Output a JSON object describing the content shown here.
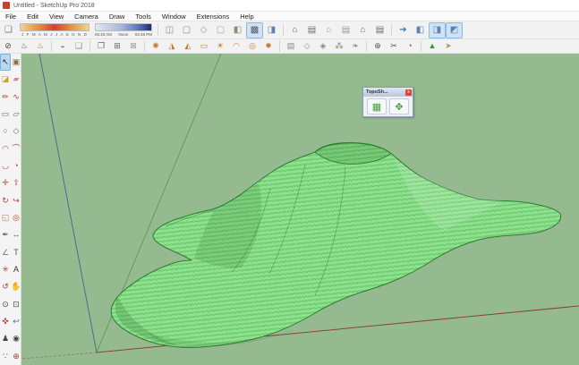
{
  "window": {
    "title": "Untitled - SketchUp Pro 2018"
  },
  "menu": {
    "items": [
      {
        "name": "menu-file",
        "label": "File"
      },
      {
        "name": "menu-edit",
        "label": "Edit"
      },
      {
        "name": "menu-view",
        "label": "View"
      },
      {
        "name": "menu-camera",
        "label": "Camera"
      },
      {
        "name": "menu-draw",
        "label": "Draw"
      },
      {
        "name": "menu-tools",
        "label": "Tools"
      },
      {
        "name": "menu-window",
        "label": "Window"
      },
      {
        "name": "menu-extensions",
        "label": "Extensions"
      },
      {
        "name": "menu-help",
        "label": "Help"
      }
    ]
  },
  "shadows": {
    "toggle_glyph": "❏",
    "months": "J F M A M J J A S O N D",
    "time_start": "06:43 AM",
    "time_mid": "Noon",
    "time_end": "04:45 PM"
  },
  "toolbar1": {
    "face_styles": [
      {
        "name": "xray-style-icon",
        "glyph": "◫",
        "color": "#7d92a8"
      },
      {
        "name": "back-edges-style-icon",
        "glyph": "▢",
        "color": "#7d92a8"
      },
      {
        "name": "wireframe-style-icon",
        "glyph": "◇",
        "color": "#8a97a3"
      },
      {
        "name": "hidden-line-style-icon",
        "glyph": "▢",
        "color": "#9aa4ad"
      },
      {
        "name": "shaded-style-icon",
        "glyph": "◧",
        "color": "#8d8d7a"
      },
      {
        "name": "shaded-textures-style-icon",
        "glyph": "▩",
        "color": "#4f5a66",
        "active": true
      },
      {
        "name": "monochrome-style-icon",
        "glyph": "◨",
        "color": "#5b82b5"
      }
    ],
    "views": [
      {
        "name": "iso-view-icon",
        "glyph": "⌂",
        "color": "#6a6a6a"
      },
      {
        "name": "top-view-icon",
        "glyph": "▤",
        "color": "#6a6a6a"
      },
      {
        "name": "front-view-icon",
        "glyph": "⌂",
        "color": "#9a9a9a"
      },
      {
        "name": "right-view-icon",
        "glyph": "▤",
        "color": "#9a9a9a"
      },
      {
        "name": "back-view-icon",
        "glyph": "⌂",
        "color": "#6a6a6a"
      },
      {
        "name": "left-view-icon",
        "glyph": "▤",
        "color": "#6a6a6a"
      }
    ],
    "extras": [
      {
        "name": "export-arrow-icon",
        "glyph": "➔",
        "color": "#3f6fb5"
      },
      {
        "name": "solid-cube-icon-1",
        "glyph": "◧",
        "color": "#5b82b5"
      },
      {
        "name": "solid-cube-icon-2",
        "glyph": "◨",
        "color": "#5b82b5",
        "active": true
      },
      {
        "name": "solid-cube-icon-3",
        "glyph": "◩",
        "color": "#5b82b5",
        "active": true
      }
    ]
  },
  "toolbar2": {
    "icons": [
      {
        "name": "no-entry-icon",
        "glyph": "⊘",
        "color": "#444"
      },
      {
        "name": "render-teapot-icon",
        "glyph": "♨",
        "color": "#555"
      },
      {
        "name": "material-teapot-icon",
        "glyph": "♨",
        "color": "#a6743d"
      },
      {
        "sep": true
      },
      {
        "name": "sunset-preview-icon",
        "glyph": "◒",
        "color": "#888"
      },
      {
        "name": "batch-render-icon",
        "glyph": "❏",
        "color": "#888"
      },
      {
        "sep": true
      },
      {
        "name": "render-window-icon",
        "glyph": "❐",
        "color": "#666"
      },
      {
        "name": "options-window-icon",
        "glyph": "⊞",
        "color": "#666"
      },
      {
        "name": "lock-icon",
        "glyph": "⊠",
        "color": "#999"
      },
      {
        "sep": true
      },
      {
        "name": "omni-light-icon",
        "glyph": "✺",
        "color": "#c07a3a"
      },
      {
        "name": "spot-light-icon",
        "glyph": "◮",
        "color": "#c07a3a"
      },
      {
        "name": "ies-light-icon",
        "glyph": "◭",
        "color": "#c07a3a"
      },
      {
        "name": "rectangle-light-icon",
        "glyph": "▭",
        "color": "#c07a3a"
      },
      {
        "name": "sphere-light-icon",
        "glyph": "☀",
        "color": "#c07a3a"
      },
      {
        "name": "dome-light-icon",
        "glyph": "◠",
        "color": "#c07a3a"
      },
      {
        "name": "mesh-light-icon",
        "glyph": "◎",
        "color": "#c07a3a"
      },
      {
        "name": "sun-light-icon",
        "glyph": "✹",
        "color": "#c07a3a"
      },
      {
        "sep": true
      },
      {
        "name": "proxy-table-icon",
        "glyph": "▤",
        "color": "#888"
      },
      {
        "name": "proxy-cube-icon",
        "glyph": "◇",
        "color": "#888"
      },
      {
        "name": "proxy-export-icon",
        "glyph": "◈",
        "color": "#888"
      },
      {
        "name": "fur-grass-icon",
        "glyph": "⁂",
        "color": "#7a8a6a"
      },
      {
        "name": "leaf-icon",
        "glyph": "❧",
        "color": "#8a9a7a"
      },
      {
        "sep": true
      },
      {
        "name": "sphere-axes-icon",
        "glyph": "⊕",
        "color": "#555"
      },
      {
        "name": "clip-tool-icon",
        "glyph": "✂",
        "color": "#555"
      },
      {
        "name": "compass-tool-icon",
        "glyph": "◔",
        "color": "#a33"
      },
      {
        "sep": true
      },
      {
        "name": "terrain-gradient-icon",
        "glyph": "▲",
        "color": "#3f8f3f"
      },
      {
        "name": "pointer-tool-icon",
        "glyph": "➤",
        "color": "#b09a6a"
      }
    ]
  },
  "sidebar": {
    "tools": [
      {
        "name": "select-tool",
        "glyph": "↖",
        "color": "#222",
        "active": true
      },
      {
        "name": "make-component-tool",
        "glyph": "▣",
        "color": "#8a6d4a"
      },
      {
        "name": "paint-bucket-tool",
        "glyph": "◪",
        "color": "#c9a227"
      },
      {
        "name": "eraser-tool",
        "glyph": "▰",
        "color": "#d98a9a"
      },
      {
        "name": "line-tool",
        "glyph": "✏",
        "color": "#b03a2e"
      },
      {
        "name": "freehand-tool",
        "glyph": "∿",
        "color": "#b03a2e"
      },
      {
        "name": "rectangle-tool",
        "glyph": "▭",
        "color": "#6a6a6a"
      },
      {
        "name": "rotated-rectangle-tool",
        "glyph": "▱",
        "color": "#6a6a6a"
      },
      {
        "name": "circle-tool",
        "glyph": "○",
        "color": "#6a6a6a"
      },
      {
        "name": "polygon-tool",
        "glyph": "◇",
        "color": "#6a6a6a"
      },
      {
        "name": "two-point-arc-tool",
        "glyph": "◠",
        "color": "#b03a2e"
      },
      {
        "name": "three-point-arc-tool",
        "glyph": "⌒",
        "color": "#b03a2e"
      },
      {
        "name": "arc-tool",
        "glyph": "◡",
        "color": "#b03a2e"
      },
      {
        "name": "pie-tool",
        "glyph": "◔",
        "color": "#b03a2e"
      },
      {
        "name": "move-tool",
        "glyph": "✛",
        "color": "#c0392b"
      },
      {
        "name": "push-pull-tool",
        "glyph": "⇧",
        "color": "#c0392b"
      },
      {
        "name": "rotate-tool",
        "glyph": "↻",
        "color": "#c0392b"
      },
      {
        "name": "follow-me-tool",
        "glyph": "↪",
        "color": "#c0392b"
      },
      {
        "name": "scale-tool",
        "glyph": "◱",
        "color": "#b08a4a"
      },
      {
        "name": "offset-tool",
        "glyph": "◎",
        "color": "#c0392b"
      },
      {
        "name": "tape-measure-tool",
        "glyph": "✒",
        "color": "#4a7a4a"
      },
      {
        "name": "dimension-tool",
        "glyph": "↔",
        "color": "#555"
      },
      {
        "name": "protractor-tool",
        "glyph": "∠",
        "color": "#5a8a5a"
      },
      {
        "name": "text-tool",
        "glyph": "T",
        "color": "#555"
      },
      {
        "name": "axes-tool",
        "glyph": "✳",
        "color": "#b03a2e"
      },
      {
        "name": "3d-text-tool",
        "glyph": "A",
        "color": "#333"
      },
      {
        "name": "orbit-tool",
        "glyph": "↺",
        "color": "#c0392b"
      },
      {
        "name": "pan-tool",
        "glyph": "✋",
        "color": "#c8a25f"
      },
      {
        "name": "zoom-tool",
        "glyph": "⊙",
        "color": "#444"
      },
      {
        "name": "zoom-window-tool",
        "glyph": "⊡",
        "color": "#444"
      },
      {
        "name": "zoom-extents-tool",
        "glyph": "✜",
        "color": "#c0392b"
      },
      {
        "name": "previous-view-tool",
        "glyph": "↩",
        "color": "#3a6ea5"
      },
      {
        "name": "position-camera-tool",
        "glyph": "♟",
        "color": "#444"
      },
      {
        "name": "look-around-tool",
        "glyph": "◉",
        "color": "#444"
      },
      {
        "name": "walk-tool",
        "glyph": "∵",
        "color": "#444"
      },
      {
        "name": "section-plane-tool",
        "glyph": "⊕",
        "color": "#b03a2e"
      }
    ]
  },
  "topo_panel": {
    "title": "TopoSh...",
    "close_glyph": "x",
    "buttons": [
      {
        "name": "topo-from-contours-icon",
        "glyph": "▦",
        "color": "#4a9e3f"
      },
      {
        "name": "topo-edit-mesh-icon",
        "glyph": "✥",
        "color": "#4a9e3f"
      }
    ]
  },
  "viewport": {
    "background": "#95ba8f",
    "axes": {
      "red": "#8a4437",
      "green": "#5f9e58",
      "blue": "#41708f"
    },
    "terrain": {
      "fill": "#8ce48c",
      "mesh": "#1f5f28",
      "outline": "#2f7c2f"
    }
  }
}
